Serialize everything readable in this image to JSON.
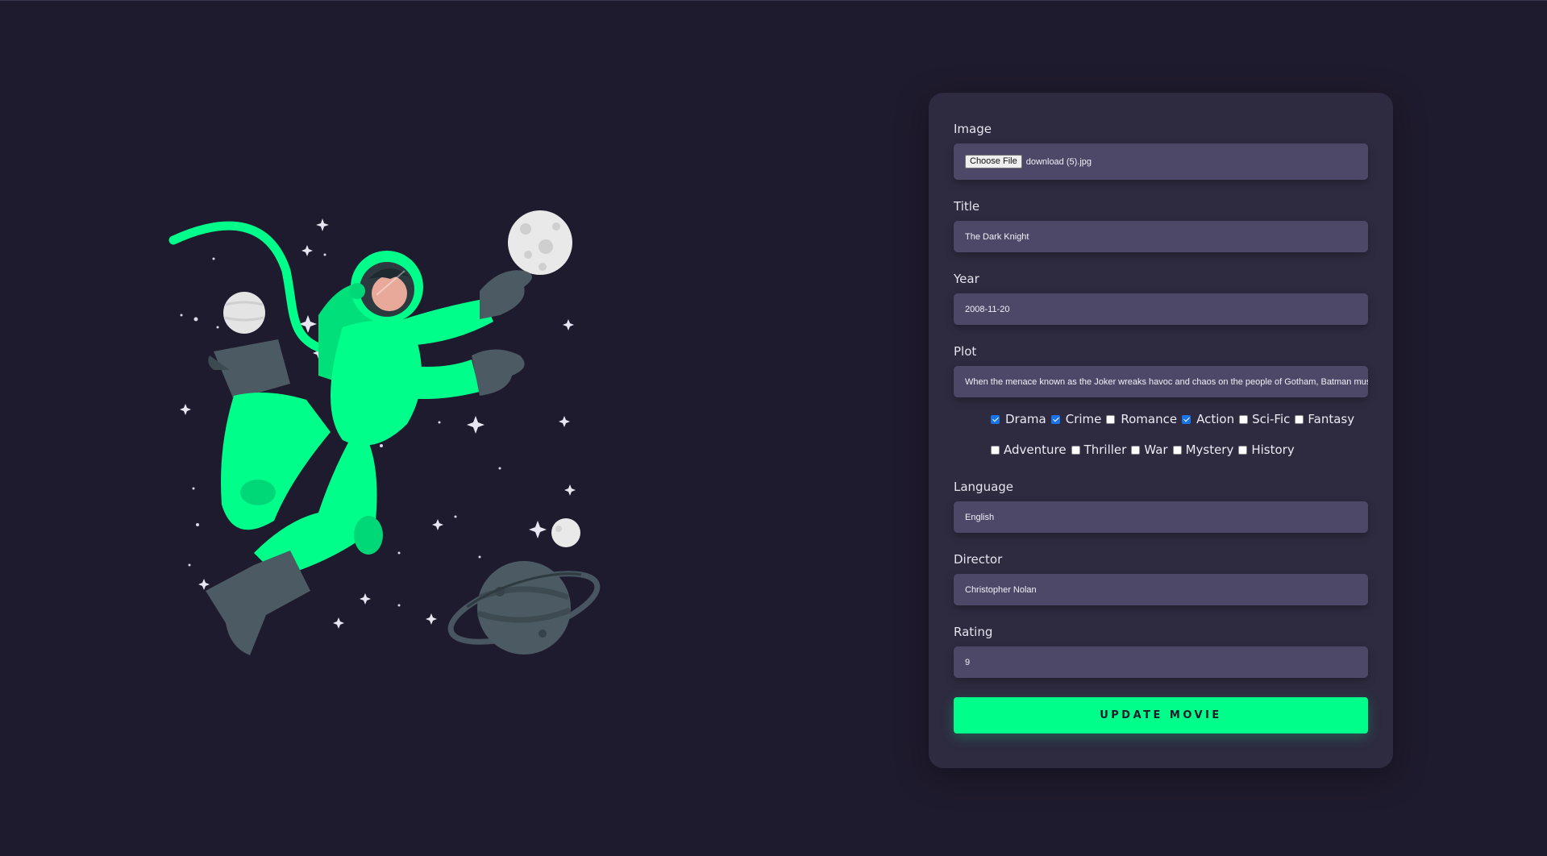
{
  "form": {
    "image": {
      "label": "Image",
      "button_label": "Choose File",
      "file_name": "download (5).jpg"
    },
    "title": {
      "label": "Title",
      "value": "The Dark Knight"
    },
    "year": {
      "label": "Year",
      "value": "2008-11-20"
    },
    "plot": {
      "label": "Plot",
      "value": "When the menace known as the Joker wreaks havoc and chaos on the people of Gotham, Batman must accept one of the greatest psychological and physical tests"
    },
    "genres": {
      "row1": [
        {
          "label": "Drama",
          "checked": true
        },
        {
          "label": "Crime",
          "checked": true
        },
        {
          "label": "Romance",
          "checked": false
        },
        {
          "label": "Action",
          "checked": true
        },
        {
          "label": "Sci-Fic",
          "checked": false
        },
        {
          "label": "Fantasy",
          "checked": false
        }
      ],
      "row2": [
        {
          "label": "Adventure",
          "checked": false
        },
        {
          "label": "Thriller",
          "checked": false
        },
        {
          "label": "War",
          "checked": false
        },
        {
          "label": "Mystery",
          "checked": false
        },
        {
          "label": "History",
          "checked": false
        }
      ]
    },
    "language": {
      "label": "Language",
      "value": "English"
    },
    "director": {
      "label": "Director",
      "value": "Christopher Nolan"
    },
    "rating": {
      "label": "Rating",
      "value": "9"
    },
    "submit_label": "UPDATE MOVIE"
  },
  "colors": {
    "background": "#1f1b2e",
    "card": "#2e2a40",
    "input": "#4e4868",
    "accent": "#00ff8a",
    "checkbox_checked": "#1a73e8"
  },
  "illustration": {
    "icon": "astronaut-in-space-illustration"
  }
}
